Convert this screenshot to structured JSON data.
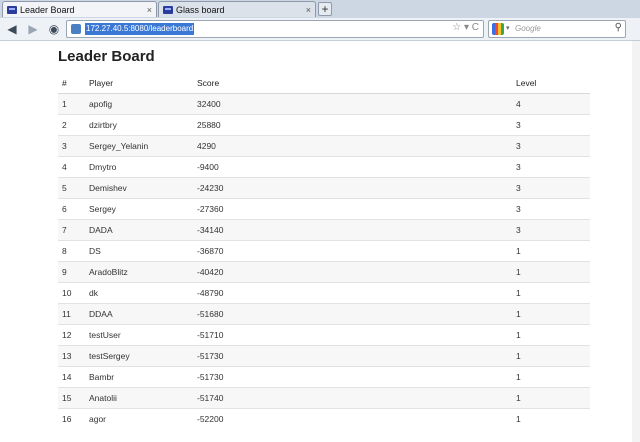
{
  "browser": {
    "tabs": [
      {
        "title": "Leader Board",
        "active": true
      },
      {
        "title": "Glass board",
        "active": false
      }
    ],
    "close_glyph": "×",
    "new_tab_glyph": "+",
    "back_icon": "back-icon",
    "forward_icon": "forward-icon",
    "home_icon": "site-identity-icon",
    "url": "172.27.40.5:8080/leaderboard",
    "url_actions": "☆ ▾ C",
    "search": {
      "placeholder": "Google",
      "caret": "▾",
      "go_glyph": "⚲"
    }
  },
  "page": {
    "title": "Leader Board",
    "columns": [
      "#",
      "Player",
      "Score",
      "Level"
    ],
    "rows": [
      {
        "rank": "1",
        "player": "apofig",
        "score": "32400",
        "level": "4"
      },
      {
        "rank": "2",
        "player": "dzirtbry",
        "score": "25880",
        "level": "3"
      },
      {
        "rank": "3",
        "player": "Sergey_Yelanin",
        "score": "4290",
        "level": "3"
      },
      {
        "rank": "4",
        "player": "Dmytro",
        "score": "-9400",
        "level": "3"
      },
      {
        "rank": "5",
        "player": "Demishev",
        "score": "-24230",
        "level": "3"
      },
      {
        "rank": "6",
        "player": "Sergey",
        "score": "-27360",
        "level": "3"
      },
      {
        "rank": "7",
        "player": "DADA",
        "score": "-34140",
        "level": "3"
      },
      {
        "rank": "8",
        "player": "DS",
        "score": "-36870",
        "level": "1"
      },
      {
        "rank": "9",
        "player": "AradoBlitz",
        "score": "-40420",
        "level": "1"
      },
      {
        "rank": "10",
        "player": "dk",
        "score": "-48790",
        "level": "1"
      },
      {
        "rank": "11",
        "player": "DDAA",
        "score": "-51680",
        "level": "1"
      },
      {
        "rank": "12",
        "player": "testUser",
        "score": "-51710",
        "level": "1"
      },
      {
        "rank": "13",
        "player": "testSergey",
        "score": "-51730",
        "level": "1"
      },
      {
        "rank": "14",
        "player": "Bambr",
        "score": "-51730",
        "level": "1"
      },
      {
        "rank": "15",
        "player": "Anatolii",
        "score": "-51740",
        "level": "1"
      },
      {
        "rank": "16",
        "player": "agor",
        "score": "-52200",
        "level": "1"
      }
    ]
  },
  "colors": {
    "tabbar": "#cdd7e3",
    "url_highlight": "#3a78d6",
    "row_stripe": "#f7f7f7"
  }
}
